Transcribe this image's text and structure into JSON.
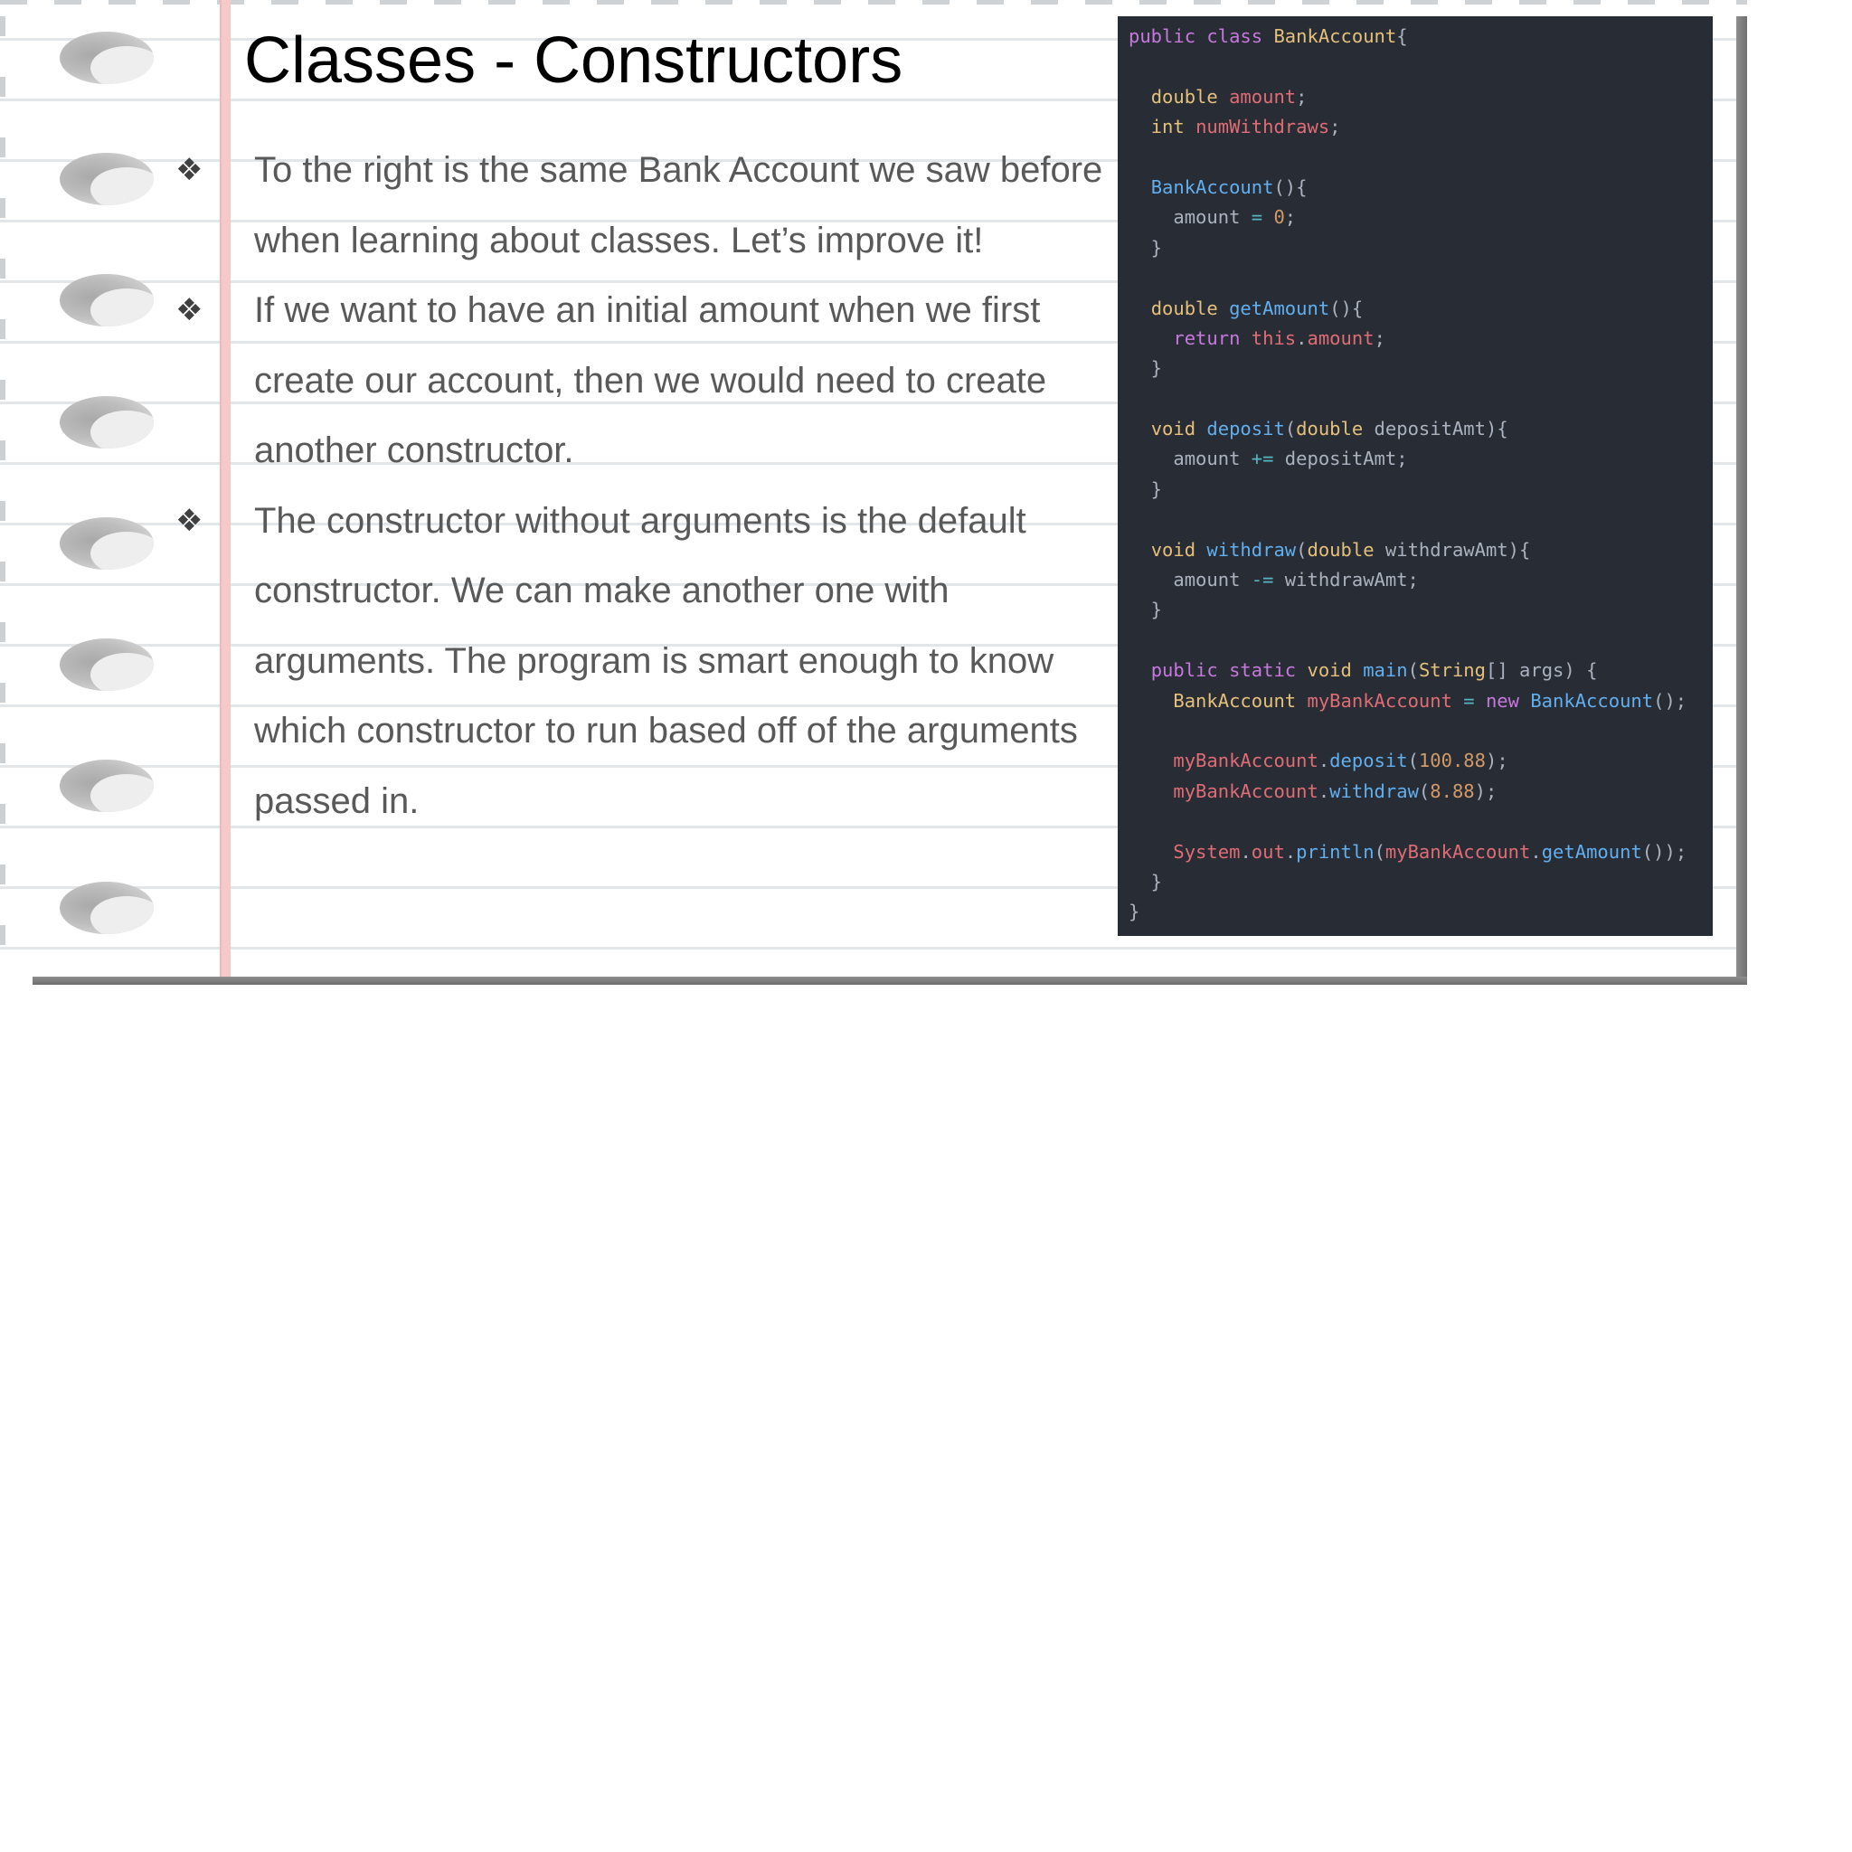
{
  "slide": {
    "title": "Classes - Constructors",
    "bullet_marker": "❖",
    "bullets": [
      "To the right is the same Bank Account we saw before when learning about classes. Let’s improve it!",
      "If we want to have an initial amount when we first create our account, then we would need to create another constructor.",
      "The constructor without arguments is the default constructor. We can make another one with arguments. The program is smart enough to know which constructor to run based off of the arguments passed in."
    ]
  },
  "code": {
    "language": "java",
    "theme_colors": {
      "background": "#282c34",
      "keyword": "#c678dd",
      "type": "#e5c07b",
      "function": "#61afef",
      "variable": "#e06c75",
      "number": "#d19a66",
      "operator": "#56b6c2",
      "plain": "#abb2bf"
    },
    "lines": [
      [
        [
          "kw",
          "public"
        ],
        [
          "pl",
          " "
        ],
        [
          "kw",
          "class"
        ],
        [
          "pl",
          " "
        ],
        [
          "type",
          "BankAccount"
        ],
        [
          "pl",
          "{"
        ]
      ],
      [],
      [
        [
          "pl",
          "  "
        ],
        [
          "type",
          "double"
        ],
        [
          "pl",
          " "
        ],
        [
          "var",
          "amount"
        ],
        [
          "pl",
          ";"
        ]
      ],
      [
        [
          "pl",
          "  "
        ],
        [
          "type",
          "int"
        ],
        [
          "pl",
          " "
        ],
        [
          "var",
          "numWithdraws"
        ],
        [
          "pl",
          ";"
        ]
      ],
      [],
      [
        [
          "pl",
          "  "
        ],
        [
          "fn",
          "BankAccount"
        ],
        [
          "pl",
          "(){"
        ]
      ],
      [
        [
          "pl",
          "    amount "
        ],
        [
          "op",
          "="
        ],
        [
          "pl",
          " "
        ],
        [
          "num",
          "0"
        ],
        [
          "pl",
          ";"
        ]
      ],
      [
        [
          "pl",
          "  }"
        ]
      ],
      [],
      [
        [
          "pl",
          "  "
        ],
        [
          "type",
          "double"
        ],
        [
          "pl",
          " "
        ],
        [
          "fn",
          "getAmount"
        ],
        [
          "pl",
          "(){"
        ]
      ],
      [
        [
          "pl",
          "    "
        ],
        [
          "kw",
          "return"
        ],
        [
          "pl",
          " "
        ],
        [
          "var",
          "this"
        ],
        [
          "pl",
          "."
        ],
        [
          "var",
          "amount"
        ],
        [
          "pl",
          ";"
        ]
      ],
      [
        [
          "pl",
          "  }"
        ]
      ],
      [],
      [
        [
          "pl",
          "  "
        ],
        [
          "type",
          "void"
        ],
        [
          "pl",
          " "
        ],
        [
          "fn",
          "deposit"
        ],
        [
          "pl",
          "("
        ],
        [
          "type",
          "double"
        ],
        [
          "pl",
          " depositAmt){"
        ]
      ],
      [
        [
          "pl",
          "    amount "
        ],
        [
          "op",
          "+="
        ],
        [
          "pl",
          " depositAmt;"
        ]
      ],
      [
        [
          "pl",
          "  }"
        ]
      ],
      [],
      [
        [
          "pl",
          "  "
        ],
        [
          "type",
          "void"
        ],
        [
          "pl",
          " "
        ],
        [
          "fn",
          "withdraw"
        ],
        [
          "pl",
          "("
        ],
        [
          "type",
          "double"
        ],
        [
          "pl",
          " withdrawAmt){"
        ]
      ],
      [
        [
          "pl",
          "    amount "
        ],
        [
          "op",
          "-="
        ],
        [
          "pl",
          " withdrawAmt;"
        ]
      ],
      [
        [
          "pl",
          "  }"
        ]
      ],
      [],
      [
        [
          "pl",
          "  "
        ],
        [
          "kw",
          "public"
        ],
        [
          "pl",
          " "
        ],
        [
          "kw",
          "static"
        ],
        [
          "pl",
          " "
        ],
        [
          "type",
          "void"
        ],
        [
          "pl",
          " "
        ],
        [
          "fn",
          "main"
        ],
        [
          "pl",
          "("
        ],
        [
          "type",
          "String"
        ],
        [
          "pl",
          "[] args) {"
        ]
      ],
      [
        [
          "pl",
          "    "
        ],
        [
          "type",
          "BankAccount"
        ],
        [
          "pl",
          " "
        ],
        [
          "var",
          "myBankAccount"
        ],
        [
          "pl",
          " "
        ],
        [
          "op",
          "="
        ],
        [
          "pl",
          " "
        ],
        [
          "kw",
          "new"
        ],
        [
          "pl",
          " "
        ],
        [
          "fn",
          "BankAccount"
        ],
        [
          "pl",
          "();"
        ]
      ],
      [],
      [
        [
          "pl",
          "    "
        ],
        [
          "var",
          "myBankAccount"
        ],
        [
          "pl",
          "."
        ],
        [
          "fn",
          "deposit"
        ],
        [
          "pl",
          "("
        ],
        [
          "num",
          "100.88"
        ],
        [
          "pl",
          ");"
        ]
      ],
      [
        [
          "pl",
          "    "
        ],
        [
          "var",
          "myBankAccount"
        ],
        [
          "pl",
          "."
        ],
        [
          "fn",
          "withdraw"
        ],
        [
          "pl",
          "("
        ],
        [
          "num",
          "8.88"
        ],
        [
          "pl",
          ");"
        ]
      ],
      [],
      [
        [
          "pl",
          "    "
        ],
        [
          "var",
          "System"
        ],
        [
          "pl",
          "."
        ],
        [
          "var",
          "out"
        ],
        [
          "pl",
          "."
        ],
        [
          "fn",
          "println"
        ],
        [
          "pl",
          "("
        ],
        [
          "var",
          "myBankAccount"
        ],
        [
          "pl",
          "."
        ],
        [
          "fn",
          "getAmount"
        ],
        [
          "pl",
          "());"
        ]
      ],
      [
        [
          "pl",
          "  }"
        ]
      ],
      [
        [
          "pl",
          "}"
        ]
      ]
    ]
  }
}
